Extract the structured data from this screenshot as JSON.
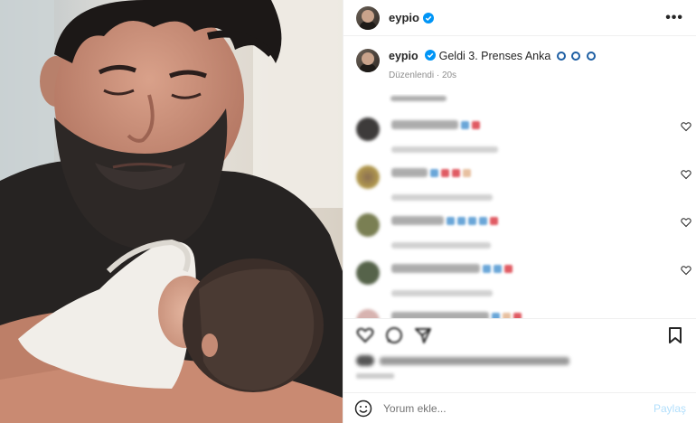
{
  "post": {
    "username": "eypio",
    "caption_text": "Geldi 3. Prenses Anka",
    "edited_label": "Düzenlendi",
    "time_ago": "20s"
  },
  "comment_box": {
    "placeholder": "Yorum ekle...",
    "post_label": "Paylaş"
  },
  "colors": {
    "verified": "#0095f6",
    "post_button": "#b2dffc",
    "caption_badge": "#1e5fa3"
  },
  "icons": [
    "more-options-icon",
    "verified-icon",
    "heart-icon",
    "comment-icon",
    "share-icon",
    "bookmark-icon",
    "emoji-icon"
  ]
}
